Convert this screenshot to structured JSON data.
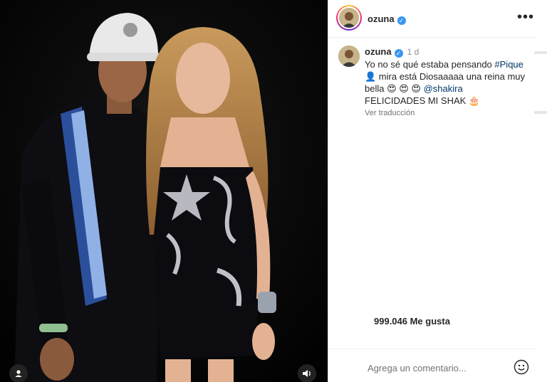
{
  "post": {
    "username": "ozuna",
    "verified": true,
    "time_ago": "1 d",
    "caption_prefix": "Yo no sé qué estaba pensando ",
    "hashtag": "#Pique",
    "caption_mid": " mira está Diosaaaaa una reina muy bella ",
    "emojis": "😍 😍 😍",
    "mention": "@shakira",
    "caption_suffix": "FELICIDADES MI SHAK 🎂",
    "translate_label": "Ver traducción",
    "likes_text": "999.046 Me gusta",
    "comment_placeholder": "Agrega un comentario...",
    "more_label": "•••"
  },
  "colors": {
    "verified": "#3897f0",
    "link": "#00376b",
    "muted": "#737373"
  },
  "icons": {
    "more": "more-options-icon",
    "emoji": "emoji-smile-icon",
    "tagged": "user-tag-icon",
    "sound": "speaker-icon"
  }
}
